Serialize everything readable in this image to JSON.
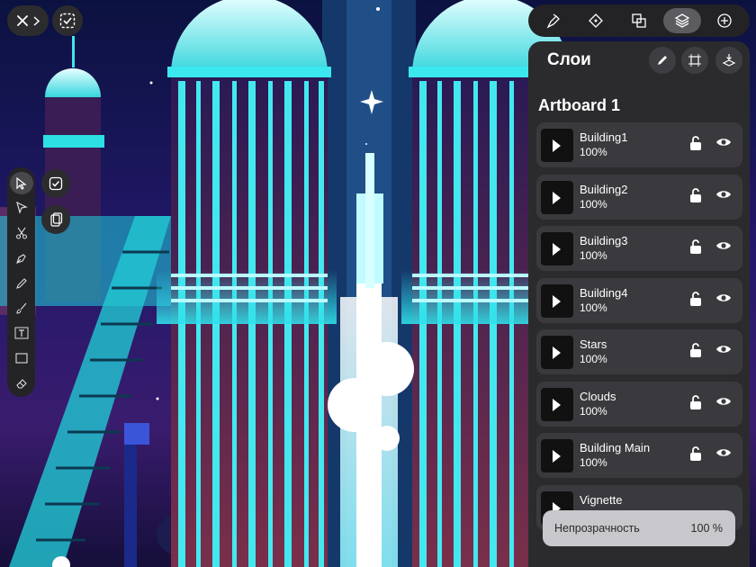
{
  "top_left": {
    "close_icon": "close-icon",
    "forward_icon": "chevron-right-icon",
    "select_icon": "dashed-checkbox-icon"
  },
  "left_toolbar": {
    "tools": [
      {
        "icon": "selection-arrow-icon",
        "active": true
      },
      {
        "icon": "direct-selection-icon",
        "active": false
      },
      {
        "icon": "scissors-icon",
        "active": false
      },
      {
        "icon": "pen-tool-icon",
        "active": false
      },
      {
        "icon": "pencil-icon",
        "active": false
      },
      {
        "icon": "brush-icon",
        "active": false
      },
      {
        "icon": "text-tool-icon",
        "active": false
      },
      {
        "icon": "rectangle-tool-icon",
        "active": false
      },
      {
        "icon": "eraser-icon",
        "active": false
      }
    ],
    "side_buttons": [
      "checkbox-icon",
      "paste-icon"
    ]
  },
  "top_tools": [
    {
      "icon": "style-brush-icon",
      "active": false
    },
    {
      "icon": "transform-icon",
      "active": false
    },
    {
      "icon": "boolean-shapes-icon",
      "active": false
    },
    {
      "icon": "layers-icon",
      "active": true
    },
    {
      "icon": "add-icon",
      "active": false
    }
  ],
  "panel": {
    "title": "Слои",
    "artboard": "Artboard 1",
    "header_buttons": [
      "edit-pencil-icon",
      "artboard-icon",
      "import-layer-icon"
    ],
    "layers": [
      {
        "name": "Building1",
        "opacity": "100%"
      },
      {
        "name": "Building2",
        "opacity": "100%"
      },
      {
        "name": "Building3",
        "opacity": "100%"
      },
      {
        "name": "Building4",
        "opacity": "100%"
      },
      {
        "name": "Stars",
        "opacity": "100%"
      },
      {
        "name": "Clouds",
        "opacity": "100%"
      },
      {
        "name": "Building Main",
        "opacity": "100%"
      },
      {
        "name": "Vignette",
        "opacity": ""
      }
    ],
    "opacity_label": "Непрозрачность",
    "opacity_value": "100 %"
  },
  "colors": {
    "accent_cyan": "#34f0f0",
    "panel_bg": "#2b2b2e",
    "row_bg": "#3a3a3e",
    "sky": "#1a1648"
  }
}
